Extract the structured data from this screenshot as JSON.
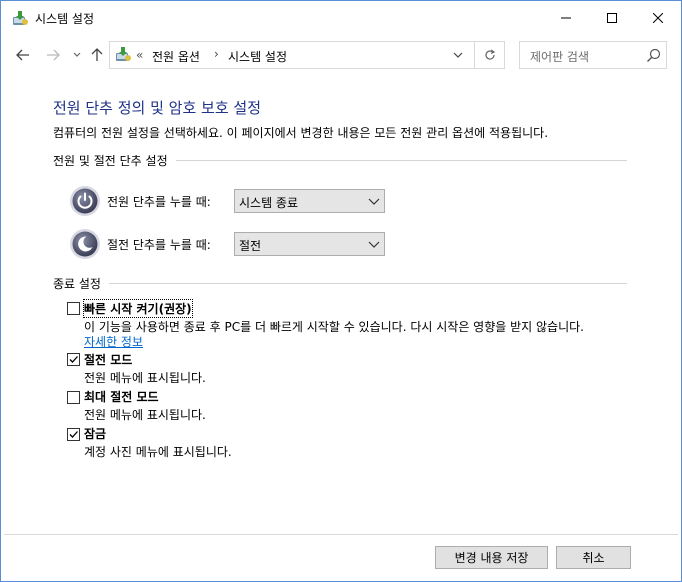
{
  "window": {
    "title": "시스템 설정",
    "controls": {
      "minimize": "minimize",
      "maximize": "maximize",
      "close": "close"
    }
  },
  "nav": {
    "address_chevron": "«",
    "breadcrumbs": [
      "전원 옵션",
      "시스템 설정"
    ],
    "separator": "›",
    "search_placeholder": "제어판 검색"
  },
  "page": {
    "title": "전원 단추 정의 및 암호 보호 설정",
    "subtitle": "컴퓨터의 전원 설정을 선택하세요. 이 페이지에서 변경한 내용은 모든 전원 관리 옵션에 적용됩니다."
  },
  "power_section": {
    "header": "전원 및 절전 단추 설정",
    "rows": [
      {
        "label": "전원 단추를 누를 때:",
        "value": "시스템 종료",
        "icon": "power-button-icon"
      },
      {
        "label": "절전 단추를 누를 때:",
        "value": "절전",
        "icon": "sleep-button-icon"
      }
    ]
  },
  "shutdown_section": {
    "header": "종료 설정",
    "options": [
      {
        "label": "빠른 시작 켜기(권장)",
        "checked": false,
        "description": "이 기능을 사용하면 종료 후 PC를 더 빠르게 시작할 수 있습니다. 다시 시작은 영향을 받지 않습니다.",
        "link": "자세한 정보"
      },
      {
        "label": "절전 모드",
        "checked": true,
        "description": "전원 메뉴에 표시됩니다."
      },
      {
        "label": "최대 절전 모드",
        "checked": false,
        "description": "전원 메뉴에 표시됩니다."
      },
      {
        "label": "잠금",
        "checked": true,
        "description": "계정 사진 메뉴에 표시됩니다."
      }
    ]
  },
  "footer": {
    "save_label": "변경 내용 저장",
    "cancel_label": "취소"
  },
  "colors": {
    "title_blue": "#1e3287",
    "link_blue": "#0066cc",
    "window_border": "#5a8fd6"
  }
}
